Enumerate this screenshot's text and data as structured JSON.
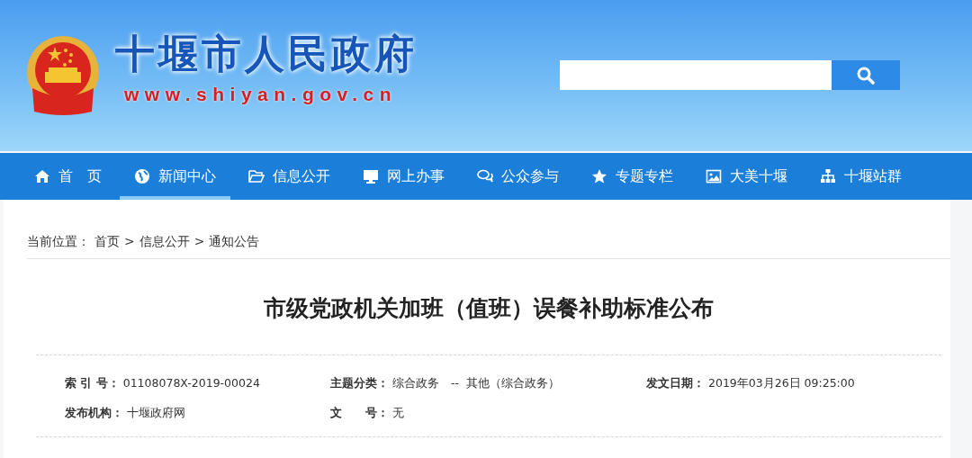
{
  "header": {
    "site_name": "十堰市人民政府",
    "site_url": "www.shiyan.gov.cn"
  },
  "nav": [
    {
      "label": "首　页",
      "selected": false
    },
    {
      "label": "新闻中心",
      "selected": true
    },
    {
      "label": "信息公开",
      "selected": false
    },
    {
      "label": "网上办事",
      "selected": false
    },
    {
      "label": "公众参与",
      "selected": false
    },
    {
      "label": "专题专栏",
      "selected": false
    },
    {
      "label": "大美十堰",
      "selected": false
    },
    {
      "label": "十堰站群",
      "selected": false
    }
  ],
  "breadcrumb": {
    "label": "当前位置：",
    "items": [
      "首页",
      "信息公开",
      "通知公告"
    ],
    "separator": ">"
  },
  "article": {
    "title": "市级党政机关加班（值班）误餐补助标准公布",
    "meta": [
      {
        "label": "索 引 号：",
        "value": "01108078X-2019-00024"
      },
      {
        "label": "主题分类：",
        "value": "综合政务　--  其他（综合政务）"
      },
      {
        "label": "发文日期：",
        "value": "2019年03月26日 09:25:00"
      },
      {
        "label": "发布机构：",
        "value": "十堰政府网"
      },
      {
        "label": "文　　号：",
        "value": "无"
      }
    ]
  }
}
